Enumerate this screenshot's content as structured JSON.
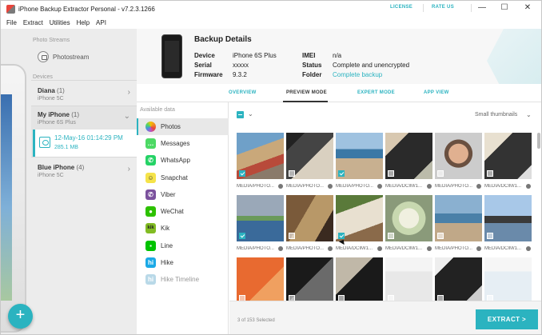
{
  "window": {
    "title": "iPhone Backup Extractor Personal - v7.2.3.1266",
    "license_label": "LICENSE",
    "rate_label": "RATE US",
    "minimize": "—",
    "maximize": "☐",
    "close": "✕"
  },
  "menu": [
    "File",
    "Extract",
    "Utilities",
    "Help",
    "API"
  ],
  "sidebar": {
    "photo_streams_label": "Photo Streams",
    "photostream_label": "Photostream",
    "devices_label": "Devices",
    "devices": [
      {
        "name": "Diana",
        "count": "(1)",
        "model": "iPhone 5C"
      },
      {
        "name": "My iPhone",
        "count": "(1)",
        "model": "iPhone 6S Plus"
      },
      {
        "name": "Blue iPhone",
        "count": "(4)",
        "model": "iPhone 5C"
      }
    ],
    "backup": {
      "date": "12-May-16 01:14:29 PM",
      "size": "285.1 MB"
    },
    "add_button": "+"
  },
  "details": {
    "title": "Backup Details",
    "rows_left": [
      {
        "key": "Device",
        "value": "iPhone 6S Plus"
      },
      {
        "key": "Serial",
        "value": "xxxxx"
      },
      {
        "key": "Firmware",
        "value": "9.3.2"
      }
    ],
    "rows_right": [
      {
        "key": "IMEI",
        "value": "n/a"
      },
      {
        "key": "Status",
        "value": "Complete and unencrypted"
      },
      {
        "key": "Folder",
        "value": "Complete backup"
      }
    ]
  },
  "tabs": [
    "OVERVIEW",
    "PREVIEW MODE",
    "EXPERT MODE",
    "APP VIEW"
  ],
  "categories": {
    "header": "Available data",
    "items": [
      {
        "label": "Photos",
        "icon": "photos-icon",
        "color": "#ffffff"
      },
      {
        "label": "Messages",
        "icon": "messages-icon",
        "color": "#4cd964"
      },
      {
        "label": "WhatsApp",
        "icon": "whatsapp-icon",
        "color": "#25d366"
      },
      {
        "label": "Snapchat",
        "icon": "snapchat-icon",
        "color": "#f5e34a"
      },
      {
        "label": "Viber",
        "icon": "viber-icon",
        "color": "#7b519d"
      },
      {
        "label": "WeChat",
        "icon": "wechat-icon",
        "color": "#2dc100"
      },
      {
        "label": "Kik",
        "icon": "kik-icon",
        "color": "#82bc23"
      },
      {
        "label": "Line",
        "icon": "line-icon",
        "color": "#00c300"
      },
      {
        "label": "Hike",
        "icon": "hike-icon",
        "color": "#1ba9e6"
      },
      {
        "label": "Hike Timeline",
        "icon": "hike-timeline-icon",
        "color": "#b9d9e8"
      }
    ]
  },
  "preview": {
    "thumb_size": "Small thumbnails",
    "captions": [
      "MEDIA/PHOTO...",
      "MEDIA/PHOTO...",
      "MEDIA/PHOTO...",
      "MEDIA/DCIM/1...",
      "MEDIA/PHOTO...",
      "MEDIA/DCIM/1...",
      "MEDIA/PHOTO...",
      "MEDIA/PHOTO...",
      "MEDIA/DCIM/1...",
      "MEDIA/DCIM/1...",
      "MEDIA/PHOTO...",
      "MEDIA/DCIM/1..."
    ],
    "checked": [
      true,
      false,
      true,
      false,
      false,
      false,
      true,
      false,
      true,
      false,
      false,
      false,
      false,
      false,
      false,
      false,
      false,
      false
    ],
    "selected_text": "3 of 153 Selected",
    "extract_label": "EXTRACT >"
  }
}
